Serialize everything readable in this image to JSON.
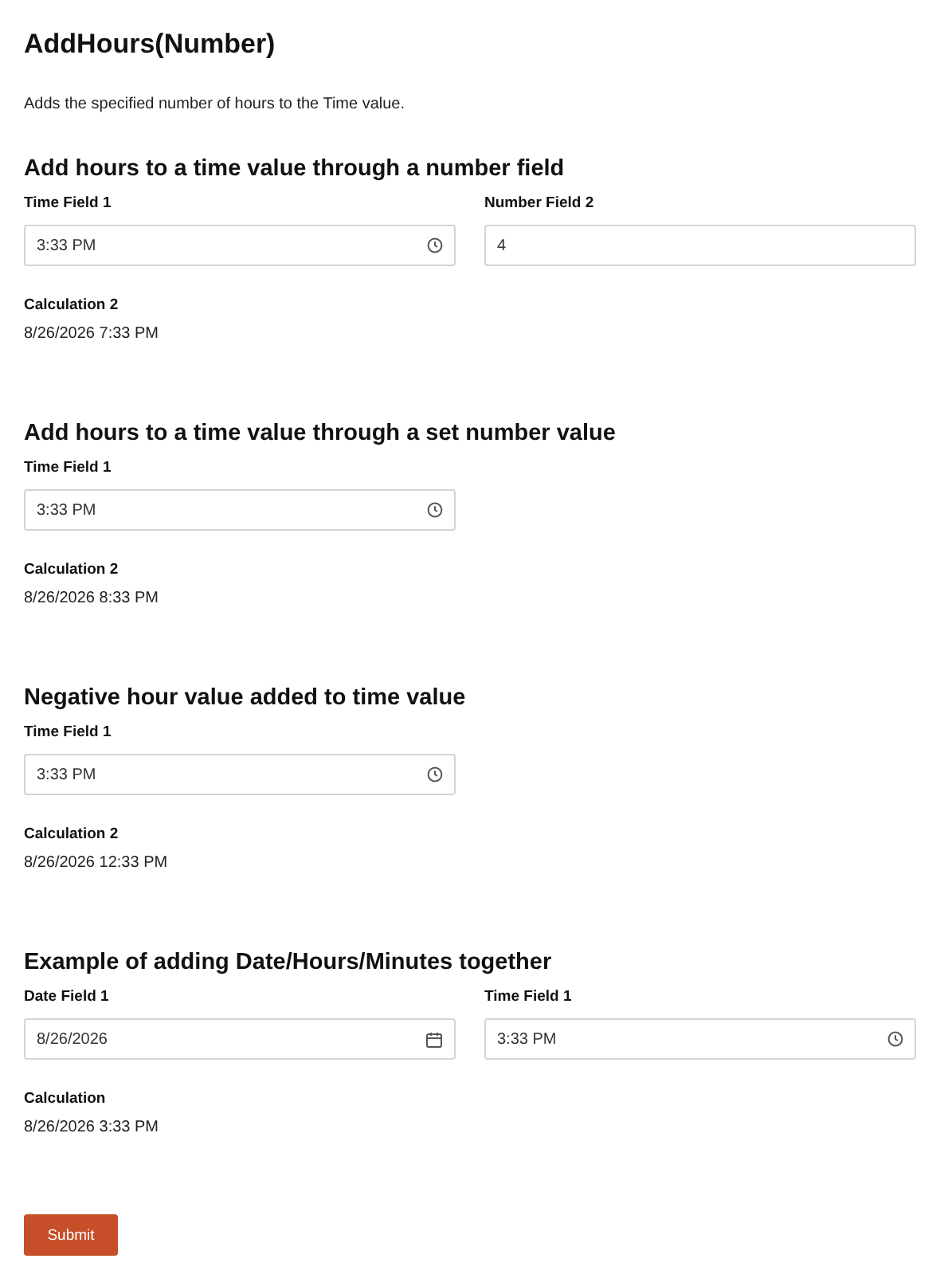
{
  "title": "AddHours(Number)",
  "description": "Adds the specified number of hours to the Time value.",
  "sections": [
    {
      "heading": "Add hours to a time value through a number field",
      "fields": [
        {
          "label": "Time Field 1",
          "kind": "time",
          "value": "3:33 PM"
        },
        {
          "label": "Number Field 2",
          "kind": "number",
          "value": "4"
        }
      ],
      "result": {
        "label": "Calculation 2",
        "value": "8/26/2026 7:33 PM"
      }
    },
    {
      "heading": "Add hours to a time value through a set number value",
      "fields": [
        {
          "label": "Time Field 1",
          "kind": "time",
          "value": "3:33 PM"
        }
      ],
      "result": {
        "label": "Calculation 2",
        "value": "8/26/2026 8:33 PM"
      }
    },
    {
      "heading": "Negative hour value added to time value",
      "fields": [
        {
          "label": "Time Field 1",
          "kind": "time",
          "value": "3:33 PM"
        }
      ],
      "result": {
        "label": "Calculation 2",
        "value": "8/26/2026 12:33 PM"
      }
    },
    {
      "heading": "Example of adding Date/Hours/Minutes together",
      "fields": [
        {
          "label": "Date Field 1",
          "kind": "date",
          "value": "8/26/2026"
        },
        {
          "label": "Time Field 1",
          "kind": "time",
          "value": "3:33 PM"
        }
      ],
      "result": {
        "label": "Calculation",
        "value": "8/26/2026 3:33 PM"
      }
    }
  ],
  "submit": "Submit"
}
